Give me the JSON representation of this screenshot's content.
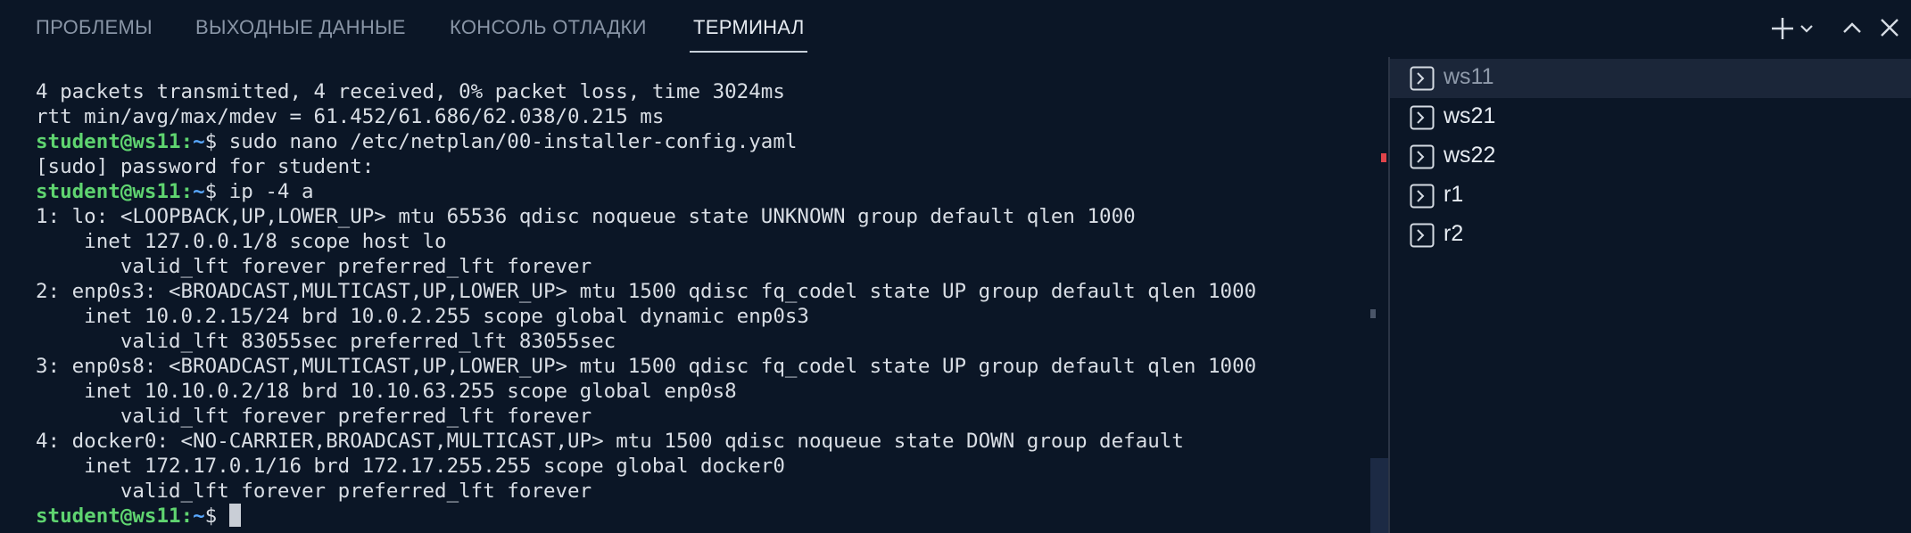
{
  "panel_tabs": [
    {
      "label": "ПРОБЛЕМЫ",
      "active": false
    },
    {
      "label": "ВЫХОДНЫЕ ДАННЫЕ",
      "active": false
    },
    {
      "label": "КОНСОЛЬ ОТЛАДКИ",
      "active": false
    },
    {
      "label": "ТЕРМИНАЛ",
      "active": true
    }
  ],
  "toolbar": {
    "new_terminal_icon": "plus-icon",
    "dropdown_icon": "chevron-down-icon",
    "maximize_icon": "chevron-up-icon",
    "close_icon": "close-icon"
  },
  "terminal": {
    "lines": [
      {
        "text": "4 packets transmitted, 4 received, 0% packet loss, time 3024ms"
      },
      {
        "text": "rtt min/avg/max/mdev = 61.452/61.686/62.038/0.215 ms"
      },
      {
        "user": "student@ws11",
        "path": "~",
        "cmd": "sudo nano /etc/netplan/00-installer-config.yaml"
      },
      {
        "text": "[sudo] password for student:"
      },
      {
        "user": "student@ws11",
        "path": "~",
        "cmd": "ip -4 a"
      },
      {
        "text": "1: lo: <LOOPBACK,UP,LOWER_UP> mtu 65536 qdisc noqueue state UNKNOWN group default qlen 1000"
      },
      {
        "text": "    inet 127.0.0.1/8 scope host lo"
      },
      {
        "text": "       valid_lft forever preferred_lft forever"
      },
      {
        "text": "2: enp0s3: <BROADCAST,MULTICAST,UP,LOWER_UP> mtu 1500 qdisc fq_codel state UP group default qlen 1000"
      },
      {
        "text": "    inet 10.0.2.15/24 brd 10.0.2.255 scope global dynamic enp0s3"
      },
      {
        "text": "       valid_lft 83055sec preferred_lft 83055sec"
      },
      {
        "text": "3: enp0s8: <BROADCAST,MULTICAST,UP,LOWER_UP> mtu 1500 qdisc fq_codel state UP group default qlen 1000"
      },
      {
        "text": "    inet 10.10.0.2/18 brd 10.10.63.255 scope global enp0s8"
      },
      {
        "text": "       valid_lft forever preferred_lft forever"
      },
      {
        "text": "4: docker0: <NO-CARRIER,BROADCAST,MULTICAST,UP> mtu 1500 qdisc noqueue state DOWN group default"
      },
      {
        "text": "    inet 172.17.0.1/16 brd 172.17.255.255 scope global docker0"
      },
      {
        "text": "       valid_lft forever preferred_lft forever"
      },
      {
        "user": "student@ws11",
        "path": "~",
        "cmd": "",
        "cursor": true
      }
    ],
    "prompt_separator": ":",
    "prompt_suffix": "$"
  },
  "terminal_list": [
    {
      "label": "ws11",
      "active": true,
      "icon": "terminal-icon"
    },
    {
      "label": "ws21",
      "active": false,
      "icon": "terminal-icon"
    },
    {
      "label": "ws22",
      "active": false,
      "icon": "terminal-icon"
    },
    {
      "label": "r1",
      "active": false,
      "icon": "terminal-icon"
    },
    {
      "label": "r2",
      "active": false,
      "icon": "terminal-icon"
    }
  ],
  "colors": {
    "background": "#0b1626",
    "prompt_user": "#5fd470",
    "prompt_path": "#59a8ff",
    "active_item_bg": "#1b2639",
    "error_marker": "#e0444a"
  }
}
